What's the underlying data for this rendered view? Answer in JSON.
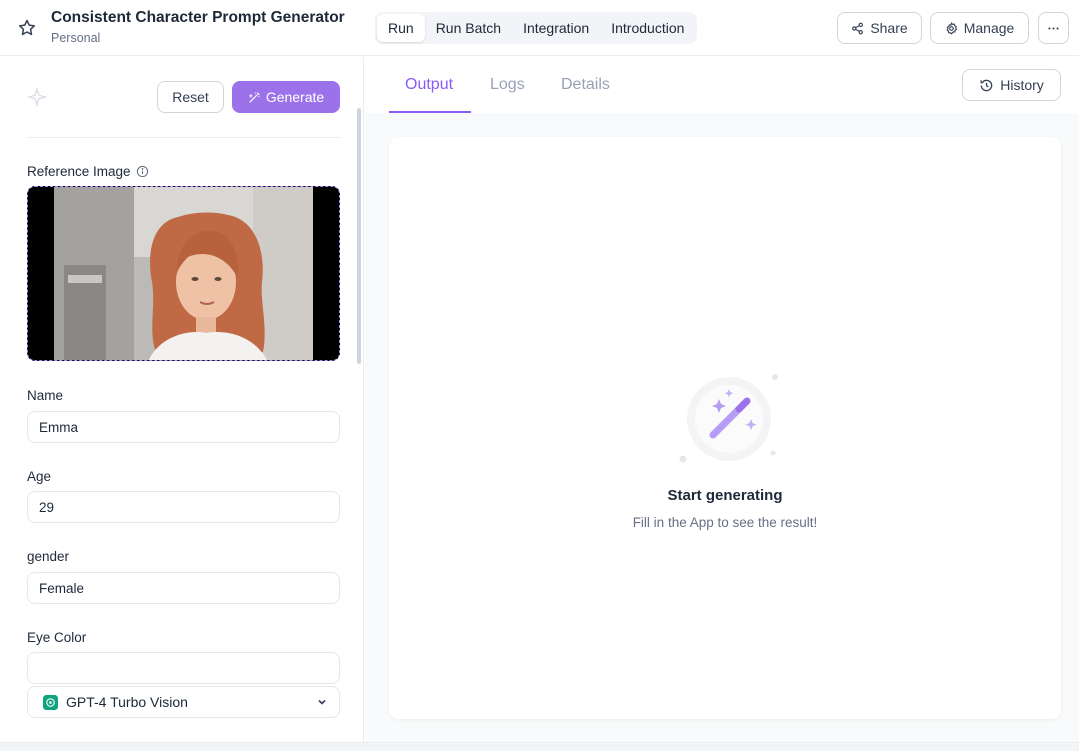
{
  "header": {
    "title": "Consistent Character Prompt Generator",
    "workspace": "Personal",
    "tabs": [
      {
        "label": "Run",
        "active": true
      },
      {
        "label": "Run Batch",
        "active": false
      },
      {
        "label": "Integration",
        "active": false
      },
      {
        "label": "Introduction",
        "active": false
      }
    ],
    "share_label": "Share",
    "manage_label": "Manage",
    "more_icon": "ellipsis-icon"
  },
  "form": {
    "reset_label": "Reset",
    "generate_label": "Generate",
    "reference_image_label": "Reference Image",
    "fields": [
      {
        "label": "Name",
        "value": "Emma"
      },
      {
        "label": "Age",
        "value": "29"
      },
      {
        "label": "gender",
        "value": "Female"
      },
      {
        "label": "Eye Color",
        "value": ""
      }
    ],
    "model": "GPT-4 Turbo Vision"
  },
  "output": {
    "tabs": [
      {
        "label": "Output",
        "active": true
      },
      {
        "label": "Logs",
        "active": false
      },
      {
        "label": "Details",
        "active": false
      }
    ],
    "history_label": "History",
    "empty_title": "Start generating",
    "empty_subtitle": "Fill in the App to see the result!"
  },
  "colors": {
    "accent": "#9b72ea",
    "accent_text": "#8b5cf6",
    "model_icon": "#10a37f"
  }
}
